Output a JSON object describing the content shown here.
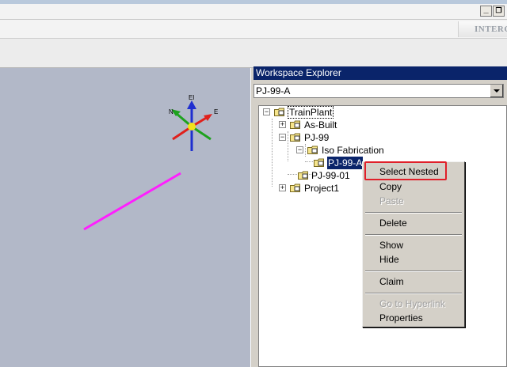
{
  "window": {
    "minimize_glyph": "_",
    "restore_glyph": "❐",
    "brand_text": "INTERGR"
  },
  "explorer": {
    "title": "Workspace Explorer",
    "workspace_filter": "PJ-99-A",
    "tree": [
      {
        "label": "TrainPlant",
        "level": 0,
        "expander": "−"
      },
      {
        "label": "As-Built",
        "level": 1,
        "expander": "+"
      },
      {
        "label": "PJ-99",
        "level": 1,
        "expander": "−"
      },
      {
        "label": "Iso Fabrication",
        "level": 2,
        "expander": "−"
      },
      {
        "label": "PJ-99-A",
        "level": 3,
        "selected": true
      },
      {
        "label": "PJ-99-01",
        "level": 2
      },
      {
        "label": "Project1",
        "level": 1,
        "expander": "+"
      }
    ]
  },
  "compass": {
    "labels": {
      "elevation": "El",
      "north": "N",
      "east": "E"
    },
    "colors": {
      "elevation": "#1f2fd0",
      "north": "#1ea21e",
      "east": "#e0201c",
      "center": "#f2e21a"
    }
  },
  "line_color": "#ff1eff",
  "context_menu": {
    "items": [
      {
        "label": "Select Nested",
        "enabled": true,
        "highlighted": true
      },
      {
        "label": "Copy",
        "enabled": true
      },
      {
        "label": "Paste",
        "enabled": false
      },
      {
        "separator": true
      },
      {
        "label": "Delete",
        "enabled": true
      },
      {
        "separator": true
      },
      {
        "label": "Show",
        "enabled": true
      },
      {
        "label": "Hide",
        "enabled": true
      },
      {
        "separator": true
      },
      {
        "label": "Claim",
        "enabled": true
      },
      {
        "separator": true
      },
      {
        "label": "Go to Hyperlink",
        "enabled": false
      },
      {
        "label": "Properties",
        "enabled": true
      }
    ]
  },
  "annotation_color": "#e0202a"
}
